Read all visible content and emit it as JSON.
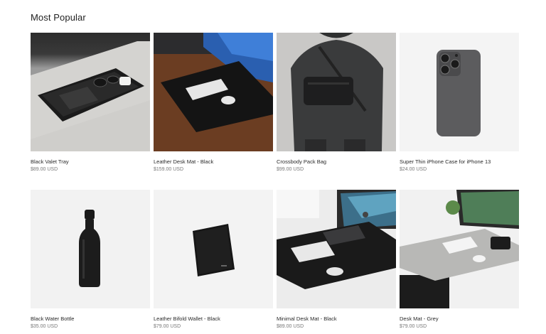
{
  "section": {
    "title": "Most Popular"
  },
  "products": [
    {
      "name": "Black Valet Tray",
      "price": "$89.00 USD"
    },
    {
      "name": "Leather Desk Mat - Black",
      "price": "$159.00 USD"
    },
    {
      "name": "Crossbody Pack Bag",
      "price": "$99.00 USD"
    },
    {
      "name": "Super Thin iPhone Case for iPhone 13",
      "price": "$24.00 USD"
    },
    {
      "name": "Black Water Bottle",
      "price": "$35.00 USD"
    },
    {
      "name": "Leather Bifold Wallet - Black",
      "price": "$79.00 USD"
    },
    {
      "name": "Minimal Desk Mat - Black",
      "price": "$89.00 USD"
    },
    {
      "name": "Desk Mat - Grey",
      "price": "$79.00 USD"
    }
  ]
}
